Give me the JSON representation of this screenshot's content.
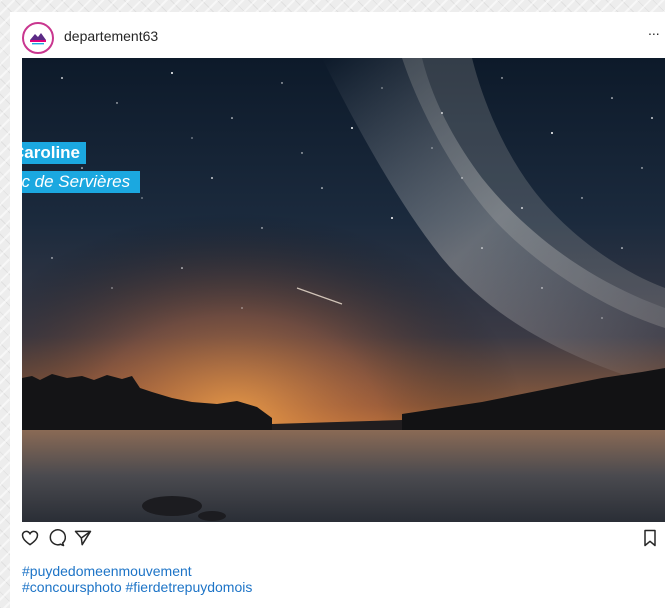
{
  "post": {
    "username": "departement63",
    "more_label": "...",
    "photo_credit": {
      "name": "Caroline",
      "place": "ac de Servières"
    },
    "hashtags": [
      "#puydedomeenmouvement",
      "#concoursphoto #fierdetrepuydomois"
    ]
  },
  "icons": {
    "like": "heart-icon",
    "comment": "comment-icon",
    "share": "send-icon",
    "save": "bookmark-icon"
  },
  "colors": {
    "tag_background": "#1ba8e0",
    "hashtag": "#1d74c7",
    "avatar_ring": "#c9368f"
  }
}
